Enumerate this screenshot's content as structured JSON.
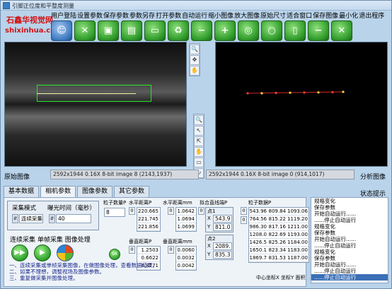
{
  "window": {
    "title": "引脚正位度和平整度测量"
  },
  "logo": {
    "line1": "石鑫华视觉网",
    "line2": "shixinhua.com"
  },
  "menu": [
    "用户登陆",
    "设置参数",
    "保存参数",
    "参数另存",
    "打开参数",
    "自动运行",
    "缩小图像",
    "放大图像",
    "原始尺寸",
    "适合窗口",
    "保存图像",
    "最小化",
    "退出程序"
  ],
  "toolbar": [
    {
      "icon": "user-icon"
    },
    {
      "icon": "tools-icon"
    },
    {
      "icon": "save-icon"
    },
    {
      "icon": "save-as-icon"
    },
    {
      "icon": "open-folder-icon"
    },
    {
      "icon": "recycle-icon"
    },
    {
      "icon": "zoom-out-icon"
    },
    {
      "icon": "zoom-in-icon"
    },
    {
      "icon": "zoom-1to1-icon"
    },
    {
      "icon": "zoom-fit-icon"
    },
    {
      "icon": "save-image-icon"
    },
    {
      "icon": "minimize-icon"
    },
    {
      "icon": "close-icon"
    }
  ],
  "left_image": {
    "info": "2592x1944 0.16X 8-bit image 8    (2143,1937)",
    "caption": "原始图像"
  },
  "right_image": {
    "info": "2592x1944 0.16X 8-bit image 0    (914,1017)",
    "caption": "分析图像"
  },
  "tabs": [
    "基本数据",
    "相机参数",
    "图像参数",
    "其它参数"
  ],
  "status_title": "状态提示",
  "camera": {
    "mode_label": "采集模式",
    "mode_value": "连续采集",
    "exposure_label": "曝光时间（毫秒）",
    "exposure_value": "40",
    "actions_label": "连续采集  单帧采集  图像处理",
    "ok_label": "OK"
  },
  "data": {
    "pin_count_label": "粒子数量P",
    "pin_count": "8",
    "hdist_px_label": "水平距离P",
    "hdist_px": [
      "220.665",
      "221.745",
      "221.856"
    ],
    "hdist_mm_label": "水平距离mm",
    "hdist_mm": [
      "1.0642",
      "1.0694",
      "1.0699"
    ],
    "vdist_px_label": "垂直距离P",
    "vdist_px": [
      "1.2503",
      "0.6622",
      "0.8771"
    ],
    "vdist_mm_label": "垂直距离mm",
    "vdist_mm": [
      "0.0060",
      "0.0032",
      "0.0042"
    ],
    "fit_line_label": "拟合直线端P",
    "point1_label": "点1",
    "point1": {
      "x": "543.9",
      "y": "811.0"
    },
    "point2_label": "点2",
    "point2": {
      "x": "2089.",
      "y": "835.3"
    },
    "particles_label": "粒子数据P",
    "particles": [
      [
        "543.96",
        "809.84",
        "1093.06"
      ],
      [
        "764.56",
        "815.22",
        "1119.20"
      ],
      [
        "986.30",
        "817.16",
        "1211.00"
      ],
      [
        "1208.0",
        "822.69",
        "1193.00"
      ],
      [
        "1426.5",
        "825.26",
        "1184.00"
      ],
      [
        "1650.1",
        "823.34",
        "1183.00"
      ],
      [
        "1869.7",
        "831.53",
        "1187.00"
      ]
    ],
    "particles_footer": "中心坐标X  坐标Y    面积"
  },
  "notes": [
    "一、连续采集或单帧采集图像，在做图像处理，查看数据结果。",
    "二、如果不理想，调整视场及图像参数。",
    "三、重复做采集并图像处理。"
  ],
  "status": [
    "规格变化",
    "保存参数",
    "开始自动运行......",
    "......停止自动运行",
    "规格变化",
    "保存参数",
    "开始自动运行......",
    "......停止自动运行",
    "规格变化",
    "保存参数",
    "开始自动运行......",
    "......停止自动运行",
    "......停止自动运行"
  ]
}
